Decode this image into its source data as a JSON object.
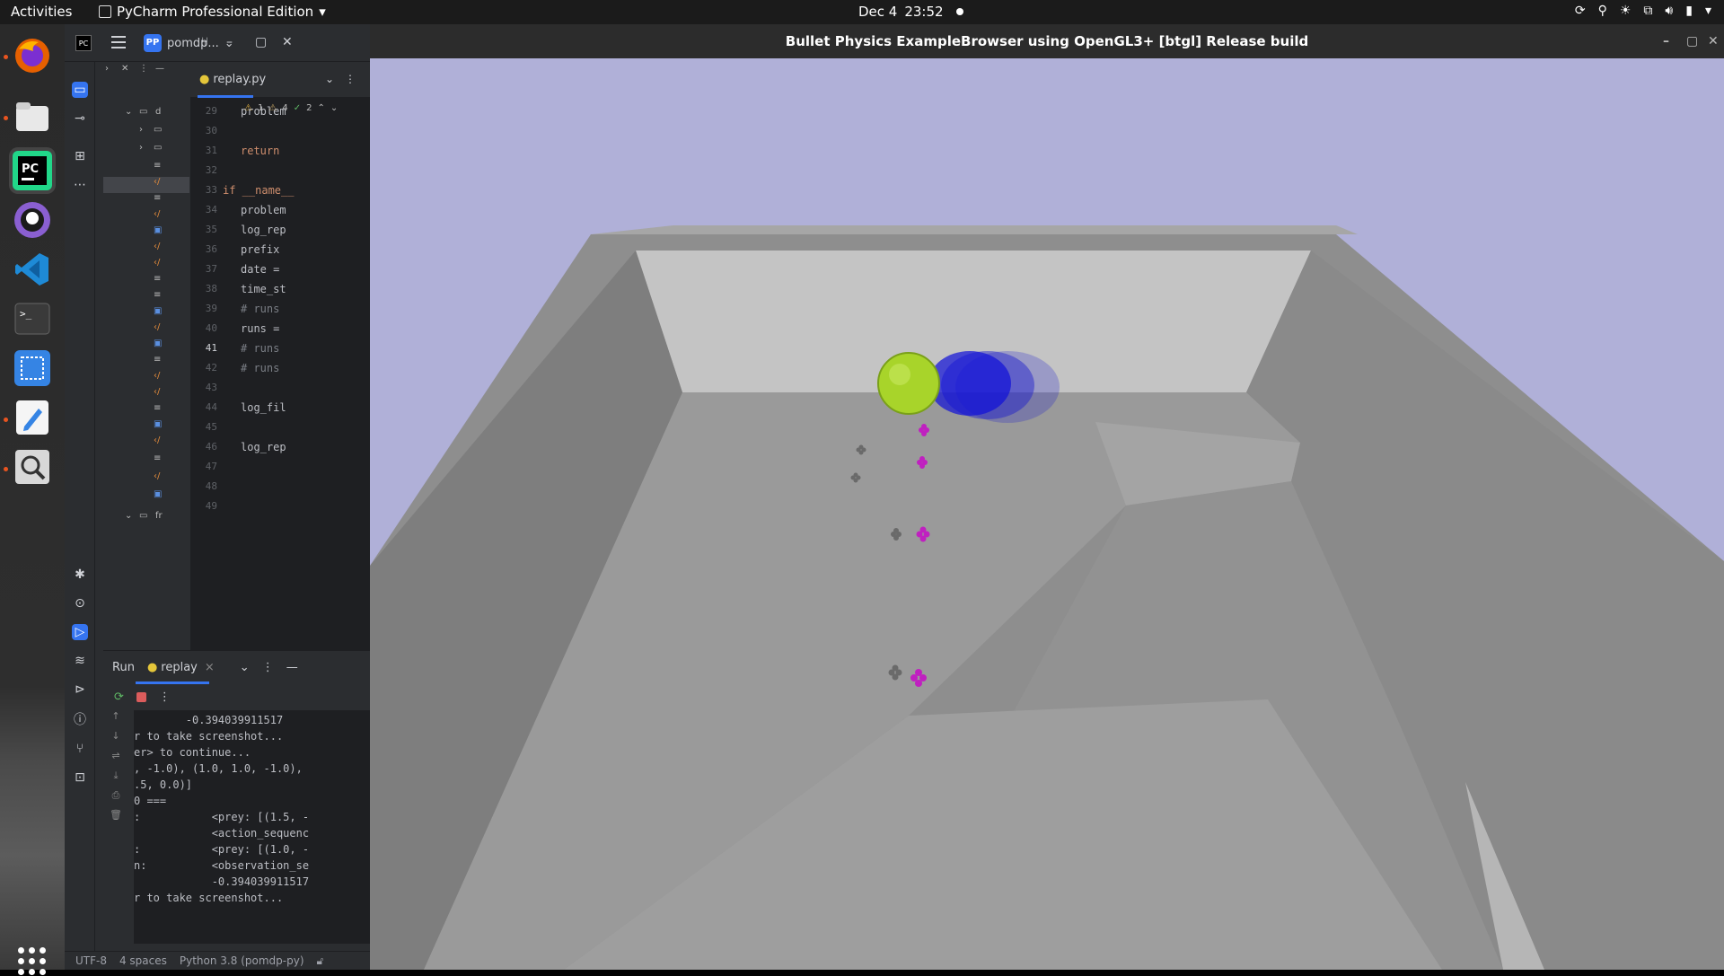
{
  "topbar": {
    "activities": "Activities",
    "app_name": "PyCharm Professional Edition",
    "date": "Dec 4",
    "time": "23:52"
  },
  "dock": {
    "items": [
      "firefox",
      "files",
      "pycharm",
      "github-desktop",
      "vscode",
      "terminal",
      "screenshot",
      "text-editor",
      "image-viewer"
    ]
  },
  "pycharm": {
    "project": "pomdp...",
    "project_badge": "PP",
    "tab_file": "replay.py",
    "inspections": {
      "warnings_a": "1",
      "warnings_b": "4",
      "ok": "2"
    },
    "tree_root_label": "d",
    "tree_fr_label": "fr",
    "code_lines": [
      {
        "num": "29",
        "text": "problem",
        "cls": ""
      },
      {
        "num": "30",
        "text": "",
        "cls": ""
      },
      {
        "num": "31",
        "text": "return",
        "cls": "kw"
      },
      {
        "num": "32",
        "text": "",
        "cls": ""
      },
      {
        "num": "33",
        "text": "if __name__",
        "cls": "kw main"
      },
      {
        "num": "34",
        "text": "problem",
        "cls": ""
      },
      {
        "num": "35",
        "text": "log_rep",
        "cls": ""
      },
      {
        "num": "36",
        "text": "prefix",
        "cls": ""
      },
      {
        "num": "37",
        "text": "date =",
        "cls": ""
      },
      {
        "num": "38",
        "text": "time_st",
        "cls": ""
      },
      {
        "num": "39",
        "text": "# runs",
        "cls": "cm"
      },
      {
        "num": "40",
        "text": "runs =",
        "cls": ""
      },
      {
        "num": "41",
        "text": "# runs",
        "cls": "cm"
      },
      {
        "num": "42",
        "text": "# runs",
        "cls": "cm"
      },
      {
        "num": "43",
        "text": "",
        "cls": ""
      },
      {
        "num": "44",
        "text": "log_fil",
        "cls": ""
      },
      {
        "num": "45",
        "text": "",
        "cls": ""
      },
      {
        "num": "46",
        "text": "log_rep",
        "cls": ""
      },
      {
        "num": "47",
        "text": "",
        "cls": ""
      },
      {
        "num": "48",
        "text": "",
        "cls": ""
      },
      {
        "num": "49",
        "text": "",
        "cls": ""
      }
    ],
    "current_line": "41",
    "run": {
      "label": "Run",
      "tab": "replay",
      "console": [
        "        -0.394039911517",
        "r to take screenshot...",
        "er> to continue...",
        ", -1.0), (1.0, 1.0, -1.0),",
        ".5, 0.0)]",
        "0 ===",
        ":           <prey: [(1.5, -",
        "            <action_sequenc",
        ":           <prey: [(1.0, -",
        "n:          <observation_se",
        "            -0.394039911517",
        "r to take screenshot..."
      ]
    },
    "status": {
      "encoding": "UTF-8",
      "indent": "4 spaces",
      "interpreter": "Python 3.8 (pomdp-py)"
    }
  },
  "bullet": {
    "title": "Bullet Physics ExampleBrowser using OpenGL3+ [btgl] Release build",
    "colors": {
      "sky": "#b0b0d8",
      "floor": "#9a9a9a",
      "ball": "#a8d42a",
      "trail": "#1a1acc",
      "marker": "#c020c0"
    }
  }
}
